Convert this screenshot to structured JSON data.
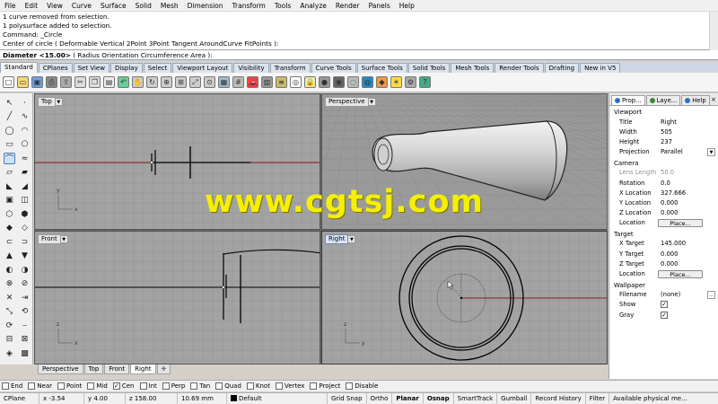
{
  "menu": [
    "File",
    "Edit",
    "View",
    "Curve",
    "Surface",
    "Solid",
    "Mesh",
    "Dimension",
    "Transform",
    "Tools",
    "Analyze",
    "Render",
    "Panels",
    "Help"
  ],
  "command_history": [
    "1 curve removed from selection.",
    "1 polysurface added to selection.",
    "Command: _Circle",
    "Center of circle ( Deformable  Vertical  2Point  3Point  Tangent  AroundCurve  FitPoints ):"
  ],
  "command_prompt": {
    "label": "Diameter <15.00>",
    "options": "( Radius  Orientation  Circumference  Area ):"
  },
  "toolbar_tabs": [
    "Standard",
    "CPlanes",
    "Set View",
    "Display",
    "Select",
    "Viewport Layout",
    "Visibility",
    "Transform",
    "Curve Tools",
    "Surface Tools",
    "Solid Tools",
    "Mesh Tools",
    "Render Tools",
    "Drafting",
    "New in V5"
  ],
  "toolbar_icons": [
    "new-file",
    "open-file",
    "save",
    "print",
    "import",
    "cut",
    "copy",
    "paste",
    "undo",
    "pan",
    "rotate-view",
    "zoom",
    "zoom-window",
    "zoom-extents",
    "zoom-selected",
    "viewports-4",
    "grid",
    "car",
    "properties",
    "layers",
    "select",
    "lock",
    "shade",
    "rendered",
    "ghosted",
    "render",
    "material",
    "light",
    "options",
    "help"
  ],
  "viewports": {
    "top": "Top",
    "perspective": "Perspective",
    "front": "Front",
    "right": "Right"
  },
  "viewport_tabs": [
    "Perspective",
    "Top",
    "Front",
    "Right"
  ],
  "axes": {
    "x": "x",
    "y": "y",
    "z": "z"
  },
  "osnaps": [
    {
      "label": "End",
      "checked": false
    },
    {
      "label": "Near",
      "checked": false
    },
    {
      "label": "Point",
      "checked": false
    },
    {
      "label": "Mid",
      "checked": false
    },
    {
      "label": "Cen",
      "checked": true
    },
    {
      "label": "Int",
      "checked": false
    },
    {
      "label": "Perp",
      "checked": false
    },
    {
      "label": "Tan",
      "checked": false
    },
    {
      "label": "Quad",
      "checked": false
    },
    {
      "label": "Knot",
      "checked": false
    },
    {
      "label": "Vertex",
      "checked": false
    },
    {
      "label": "Project",
      "checked": false
    },
    {
      "label": "Disable",
      "checked": false
    }
  ],
  "status": {
    "cplane": "CPlane",
    "x": "x -3.54",
    "y": "y 4.00",
    "z": "z 158.00",
    "units": "10.69 mm",
    "layer": "Default",
    "grid_snap": "Grid Snap",
    "ortho": "Ortho",
    "planar": "Planar",
    "osnap": "Osnap",
    "smarttrack": "SmartTrack",
    "gumball": "Gumball",
    "record_history": "Record History",
    "filter": "Filter",
    "memory": "Available physical me..."
  },
  "panel": {
    "tabs": [
      "Prop...",
      "Laye...",
      "Help"
    ],
    "viewport_section": "Viewport",
    "title_label": "Title",
    "title_value": "Right",
    "width_label": "Width",
    "width_value": "505",
    "height_label": "Height",
    "height_value": "237",
    "projection_label": "Projection",
    "projection_value": "Parallel",
    "camera_section": "Camera",
    "lens_label": "Lens Length",
    "lens_value": "50.0",
    "rotation_label": "Rotation",
    "rotation_value": "0.0",
    "xloc_label": "X Location",
    "xloc_value": "327.666",
    "yloc_label": "Y Location",
    "yloc_value": "0.000",
    "zloc_label": "Z Location",
    "zloc_value": "0.000",
    "location_label": "Location",
    "place_button": "Place...",
    "target_section": "Target",
    "xt_label": "X Target",
    "xt_value": "145.000",
    "yt_label": "Y Target",
    "yt_value": "0.000",
    "zt_label": "Z Target",
    "zt_value": "0.000",
    "tlocation_label": "Location",
    "tplace_button": "Place...",
    "wallpaper_section": "Wallpaper",
    "filename_label": "Filename",
    "filename_value": "(none)",
    "show_label": "Show",
    "gray_label": "Gray"
  },
  "watermark": "www.cgtsj.com",
  "colors": {
    "viewport_bg": "#a3a3a3",
    "grid": "#8e8e8e",
    "x_axis": "#8b1a1a",
    "y_axis": "#1a6b1a",
    "accent": "#f4f000"
  }
}
